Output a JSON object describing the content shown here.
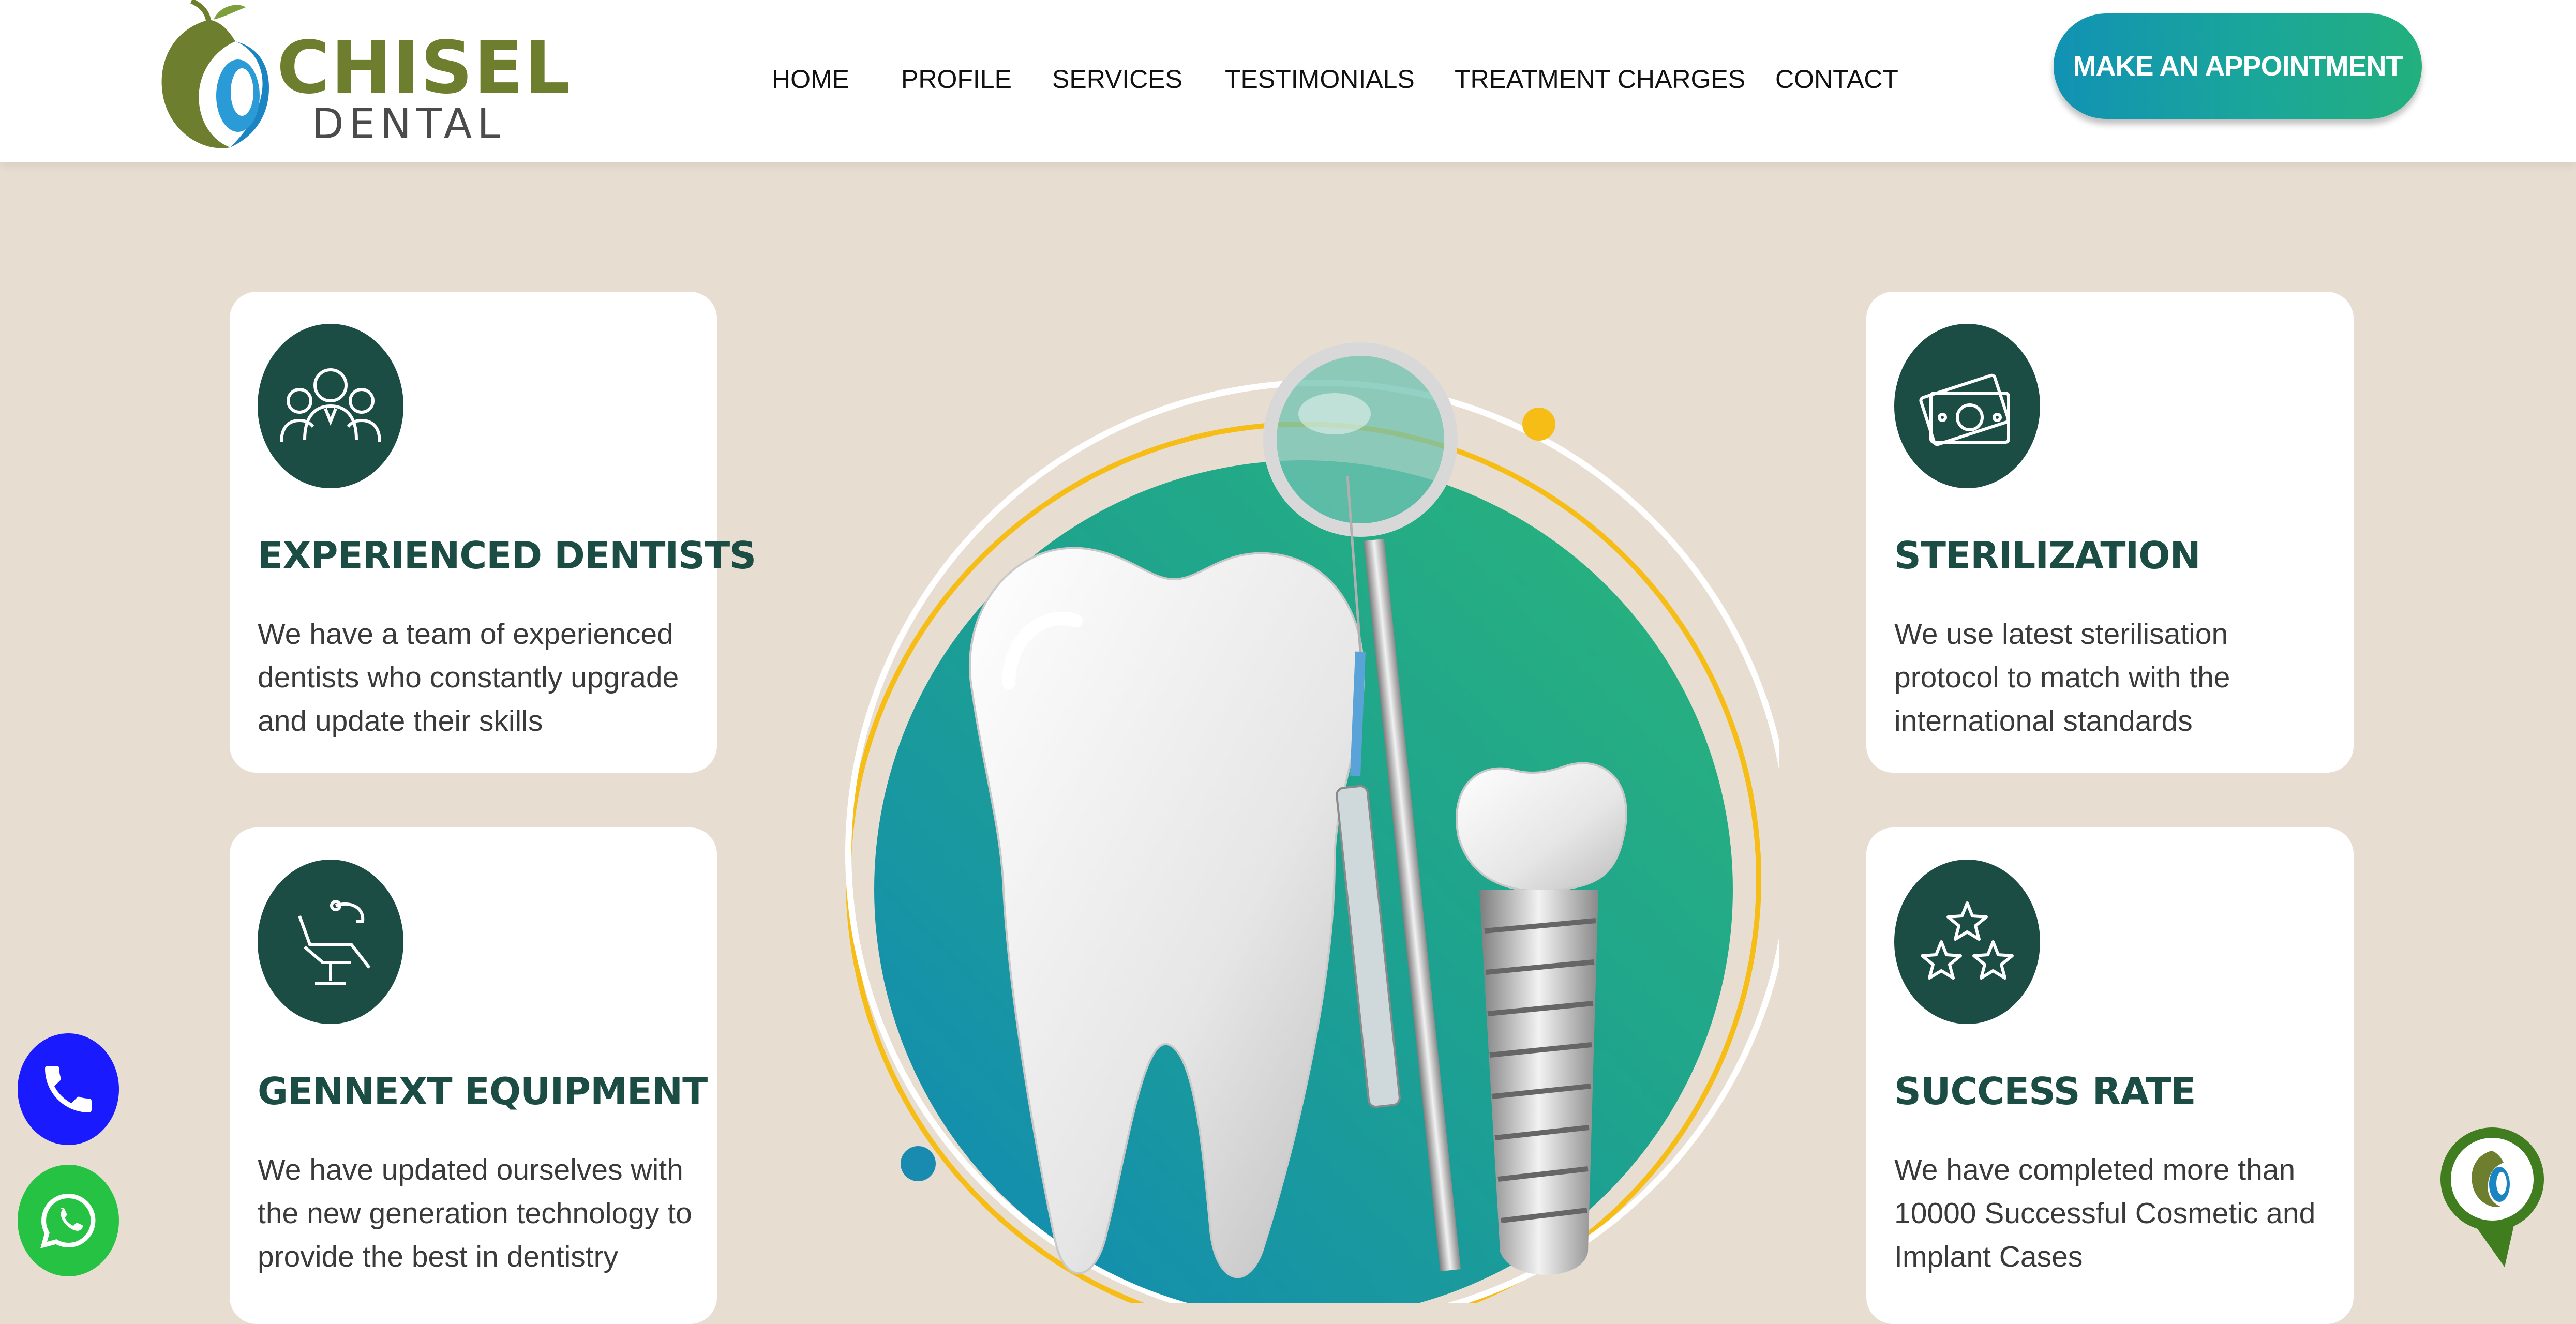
{
  "brand": {
    "name": "CHISEL",
    "subtitle": "DENTAL"
  },
  "nav": [
    {
      "label": "HOME"
    },
    {
      "label": "PROFILE"
    },
    {
      "label": "SERVICES"
    },
    {
      "label": "TESTIMONIALS"
    },
    {
      "label": "TREATMENT CHARGES"
    },
    {
      "label": "CONTACT"
    }
  ],
  "cta": {
    "label": "MAKE AN APPOINTMENT"
  },
  "features": [
    {
      "title": "EXPERIENCED DENTISTS",
      "description": "We have a team of experienced dentists who constantly upgrade and update their skills",
      "icon": "team-icon"
    },
    {
      "title": "STERILIZATION",
      "description": "We use latest sterilisation protocol to match with the international standards",
      "icon": "money-icon"
    },
    {
      "title": "GENNEXT EQUIPMENT",
      "description": "We have updated ourselves with the new generation technology to provide the best in dentistry",
      "icon": "dental-chair-icon"
    },
    {
      "title": "SUCCESS RATE",
      "description": "We have completed more than 10000 Successful Cosmetic and Implant Cases",
      "icon": "stars-icon"
    }
  ],
  "colors": {
    "brand_green": "#1c4d44",
    "logo_olive": "#6d7f2e",
    "cta_start": "#1192b4",
    "cta_end": "#23b07d",
    "page_bg": "#e7ddd0",
    "phone_button": "#1a1aff",
    "whatsapp_button": "#25c244",
    "accent_yellow": "#f6bd16"
  },
  "floating": {
    "phone_icon": "phone-icon",
    "whatsapp_icon": "whatsapp-icon",
    "chat_icon": "chat-logo-icon"
  }
}
